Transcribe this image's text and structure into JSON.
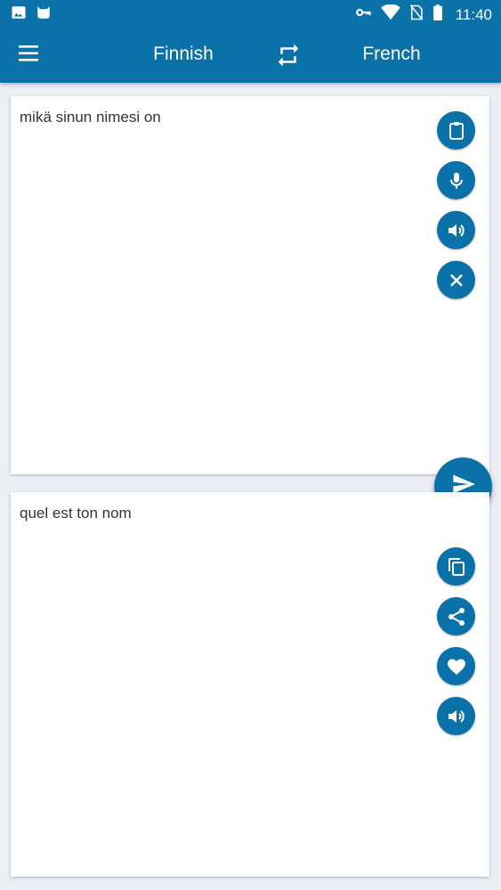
{
  "status_bar": {
    "time": "11:40",
    "left_icons": [
      "image-icon",
      "cat-icon"
    ],
    "right_icons": [
      "key-icon",
      "wifi-icon",
      "no-sim-icon",
      "battery-icon"
    ]
  },
  "app_bar": {
    "menu_icon": "menu-icon",
    "source_language": "Finnish",
    "target_language": "French",
    "swap_icon": "swap-icon"
  },
  "source": {
    "text": "mikä sinun nimesi on",
    "actions": [
      "paste-icon",
      "microphone-icon",
      "speaker-icon",
      "clear-icon"
    ]
  },
  "translate_button_icon": "send-icon",
  "target": {
    "text": "quel est ton nom",
    "actions": [
      "copy-icon",
      "share-icon",
      "favorite-icon",
      "speaker-icon"
    ]
  },
  "colors": {
    "primary": "#0a72a8",
    "background": "#ebeef3",
    "card": "#ffffff",
    "text": "#333333"
  }
}
